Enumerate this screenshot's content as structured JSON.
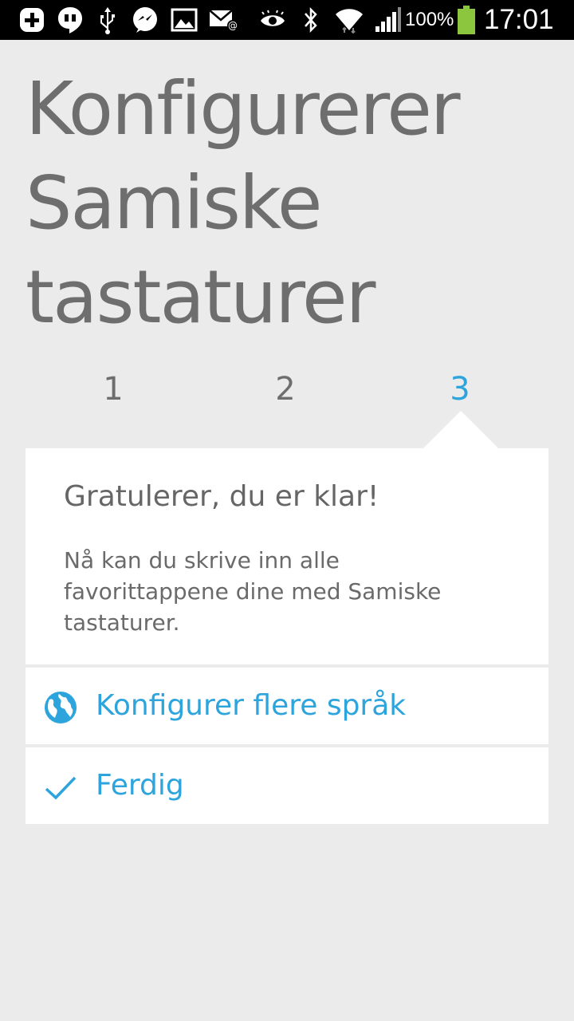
{
  "status_bar": {
    "battery_percent": "100%",
    "time": "17:01",
    "icons": [
      "add-icon",
      "hangouts-icon",
      "usb-icon",
      "messenger-icon",
      "gallery-icon",
      "email-icon",
      "eye-icon",
      "bluetooth-icon",
      "wifi-icon",
      "signal-icon",
      "battery-icon"
    ],
    "battery_color": "#8cc63f"
  },
  "title": "Konfigurerer Samiske tastaturer",
  "steps": [
    {
      "label": "1",
      "active": false
    },
    {
      "label": "2",
      "active": false
    },
    {
      "label": "3",
      "active": true
    }
  ],
  "card": {
    "heading": "Gratulerer, du er klar!",
    "body": "Nå kan du skrive inn alle favorittappene dine med Samiske tastaturer."
  },
  "actions": [
    {
      "icon": "globe-icon",
      "label": "Konfigurer flere språk"
    },
    {
      "icon": "checkmark-icon",
      "label": "Ferdig"
    }
  ],
  "colors": {
    "accent": "#2ea4dd",
    "background": "#ebebeb",
    "text": "#6e6e6e"
  }
}
